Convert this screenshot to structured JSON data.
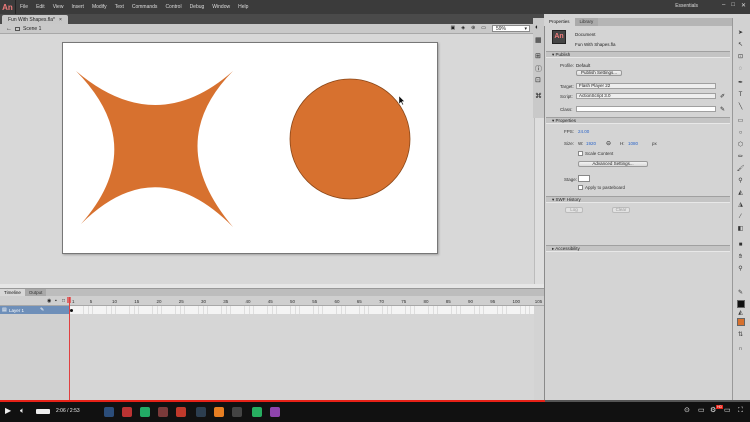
{
  "app": {
    "logo": "An",
    "menu": [
      "File",
      "Edit",
      "View",
      "Insert",
      "Modify",
      "Text",
      "Commands",
      "Control",
      "Debug",
      "Window",
      "Help"
    ],
    "workspace": "Essentials",
    "document_tab": "Fun With Shapes.fla*",
    "scene": "Scene 1",
    "zoom": "59%"
  },
  "stage": {
    "shape_color": "#d7712f",
    "shape_stroke": "#8a4617",
    "background": "#ffffff"
  },
  "timeline": {
    "tabs": [
      "Timeline",
      "Output"
    ],
    "layer_name": "Layer 1",
    "frame_ticks": [
      "1",
      "5",
      "10",
      "15",
      "20",
      "25",
      "30",
      "35",
      "40",
      "45",
      "50",
      "55",
      "60",
      "65",
      "70",
      "75",
      "80",
      "85",
      "90",
      "95",
      "100",
      "105",
      "110",
      "115",
      "120",
      "125",
      "130",
      "135",
      "14"
    ]
  },
  "properties": {
    "tabs": [
      "Properties",
      "Library"
    ],
    "doc_type": "Document",
    "doc_name": "Fun With Shapes.fla",
    "publish": {
      "section": "Publish",
      "profile_label": "Profile:",
      "profile_value": "Default",
      "publish_settings_btn": "Publish Settings...",
      "target_label": "Target:",
      "target_value": "Flash Player 22",
      "script_label": "Script:",
      "script_value": "ActionScript 3.0",
      "class_label": "Class:"
    },
    "properties_section": {
      "section": "Properties",
      "fps_label": "FPS:",
      "fps_value": "24.00",
      "size_label": "Size:",
      "w_label": "W:",
      "w_value": "1920",
      "h_label": "H:",
      "h_value": "1080",
      "unit": "px",
      "scale_content": "Scale Content",
      "advanced_btn": "Advanced Settings...",
      "stage_label": "Stage:",
      "apply_pasteboard": "Apply to pasteboard"
    },
    "swf_history": {
      "section": "SWF History",
      "log_btn": "Log",
      "clear_btn": "Clear"
    },
    "accessibility": "Accessibility"
  },
  "video": {
    "time": "2:06 / 2:53",
    "progress": 0.727,
    "hd_label": "HD"
  }
}
